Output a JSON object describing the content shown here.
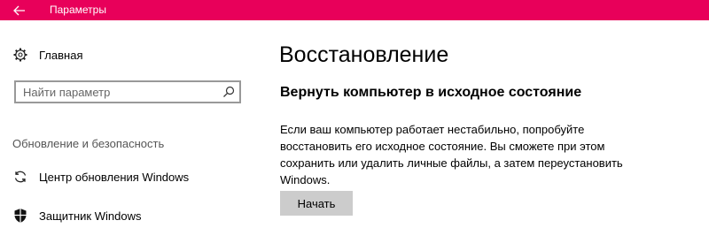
{
  "window": {
    "title": "Параметры"
  },
  "sidebar": {
    "home_label": "Главная",
    "search_placeholder": "Найти параметр",
    "section_header": "Обновление и безопасность",
    "items": [
      {
        "label": "Центр обновления Windows",
        "icon": "sync-icon"
      },
      {
        "label": "Защитник Windows",
        "icon": "shield-icon"
      }
    ]
  },
  "main": {
    "title": "Восстановление",
    "section_title": "Вернуть компьютер в исходное состояние",
    "description": "Если ваш компьютер работает нестабильно, попробуйте восстановить его исходное состояние. Вы сможете при этом сохранить или удалить личные файлы, а затем переустановить Windows.",
    "button_label": "Начать"
  },
  "colors": {
    "accent": "#e8005a",
    "button_bg": "#cccccc"
  }
}
